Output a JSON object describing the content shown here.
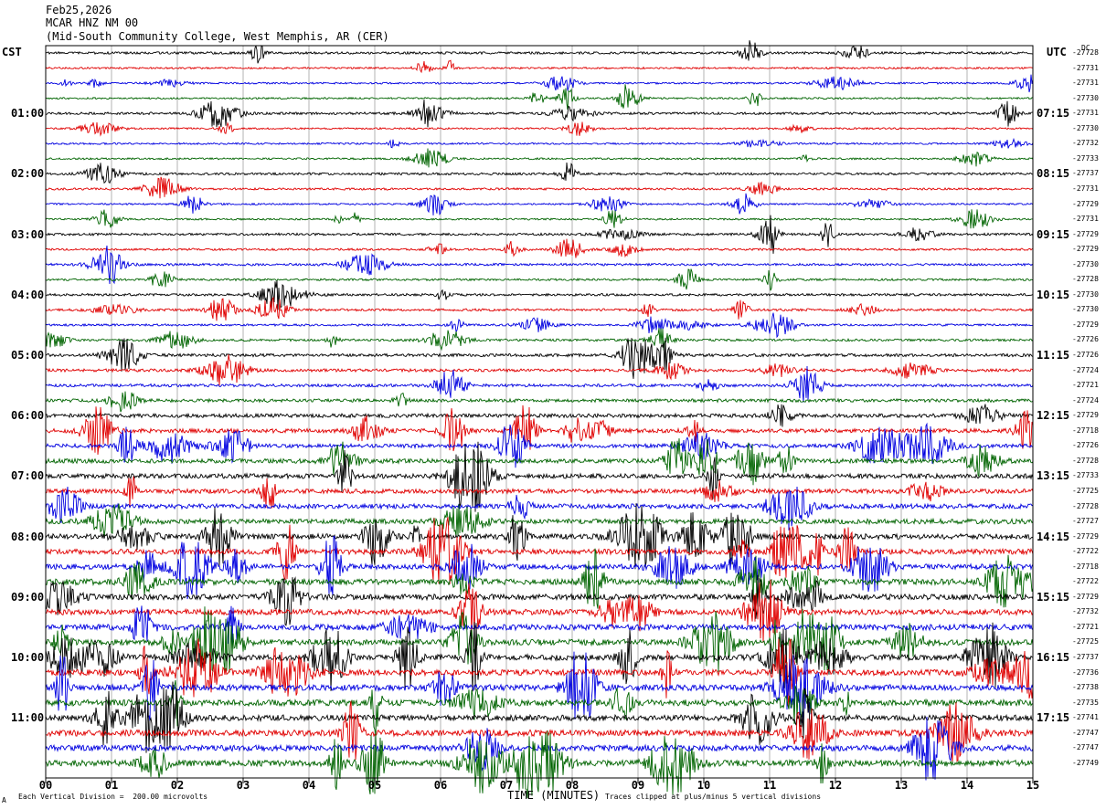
{
  "header": {
    "date": "Feb25,2026",
    "station": "MCAR HNZ NM 00",
    "location": "(Mid-South Community College, West Memphis, AR (CER)"
  },
  "left_label": "CST",
  "right_label": "UTC",
  "right_unit": "DC",
  "footer": {
    "scale": "Each Vertical Division =  200.00 microvolts",
    "xlabel": "TIME (MINUTES)",
    "clip_note": "Traces clipped at plus/minus 5 vertical divisions",
    "corner": "A"
  },
  "colors": {
    "black": "#000000",
    "red": "#e00000",
    "blue": "#0000e0",
    "green": "#006400",
    "grid": "#808080"
  },
  "chart_data": {
    "type": "line",
    "title": "MCAR HNZ NM 00",
    "xlabel": "TIME (MINUTES)",
    "xlim": [
      0,
      15
    ],
    "x_ticks": [
      "00",
      "01",
      "02",
      "03",
      "04",
      "05",
      "06",
      "07",
      "08",
      "09",
      "10",
      "11",
      "12",
      "13",
      "14",
      "15"
    ],
    "trace_colors": [
      "black",
      "red",
      "blue",
      "green"
    ],
    "left_hour_labels": [
      {
        "row": 4,
        "label": "01:00"
      },
      {
        "row": 8,
        "label": "02:00"
      },
      {
        "row": 12,
        "label": "03:00"
      },
      {
        "row": 16,
        "label": "04:00"
      },
      {
        "row": 20,
        "label": "05:00"
      },
      {
        "row": 24,
        "label": "06:00"
      },
      {
        "row": 28,
        "label": "07:00"
      },
      {
        "row": 32,
        "label": "08:00"
      },
      {
        "row": 36,
        "label": "09:00"
      },
      {
        "row": 40,
        "label": "10:00"
      },
      {
        "row": 44,
        "label": "11:00"
      }
    ],
    "right_hour_labels": [
      {
        "row": 4,
        "label": "07:15"
      },
      {
        "row": 8,
        "label": "08:15"
      },
      {
        "row": 12,
        "label": "09:15"
      },
      {
        "row": 16,
        "label": "10:15"
      },
      {
        "row": 20,
        "label": "11:15"
      },
      {
        "row": 24,
        "label": "12:15"
      },
      {
        "row": 28,
        "label": "13:15"
      },
      {
        "row": 32,
        "label": "14:15"
      },
      {
        "row": 36,
        "label": "15:15"
      },
      {
        "row": 40,
        "label": "16:15"
      },
      {
        "row": 44,
        "label": "17:15"
      }
    ],
    "dc_offsets": [
      "-27728",
      "-27731",
      "-27731",
      "-27730",
      "-27731",
      "-27730",
      "-27732",
      "-27733",
      "-27737",
      "-27731",
      "-27729",
      "-27731",
      "-27729",
      "-27729",
      "-27730",
      "-27728",
      "-27730",
      "-27730",
      "-27729",
      "-27726",
      "-27726",
      "-27724",
      "-27721",
      "-27724",
      "-27729",
      "-27718",
      "-27726",
      "-27728",
      "-27733",
      "-27725",
      "-27728",
      "-27727",
      "-27729",
      "-27722",
      "-27718",
      "-27722",
      "-27729",
      "-27732",
      "-27721",
      "-27725",
      "-27737",
      "-27736",
      "-27738",
      "-27735",
      "-27741",
      "-27747",
      "-27747",
      "-27749"
    ],
    "row_activity": [
      0.8,
      0.6,
      0.6,
      0.6,
      0.8,
      0.6,
      0.6,
      0.6,
      0.8,
      0.7,
      0.6,
      0.6,
      0.8,
      0.7,
      0.8,
      0.7,
      0.8,
      0.8,
      0.7,
      0.8,
      1.0,
      1.0,
      1.0,
      1.1,
      1.3,
      1.4,
      1.3,
      1.5,
      1.6,
      1.5,
      1.6,
      1.7,
      1.8,
      1.8,
      1.8,
      2.0,
      1.9,
      1.9,
      2.0,
      2.0,
      2.0,
      2.0,
      2.0,
      2.1,
      2.0,
      2.1,
      2.0,
      2.1
    ]
  }
}
